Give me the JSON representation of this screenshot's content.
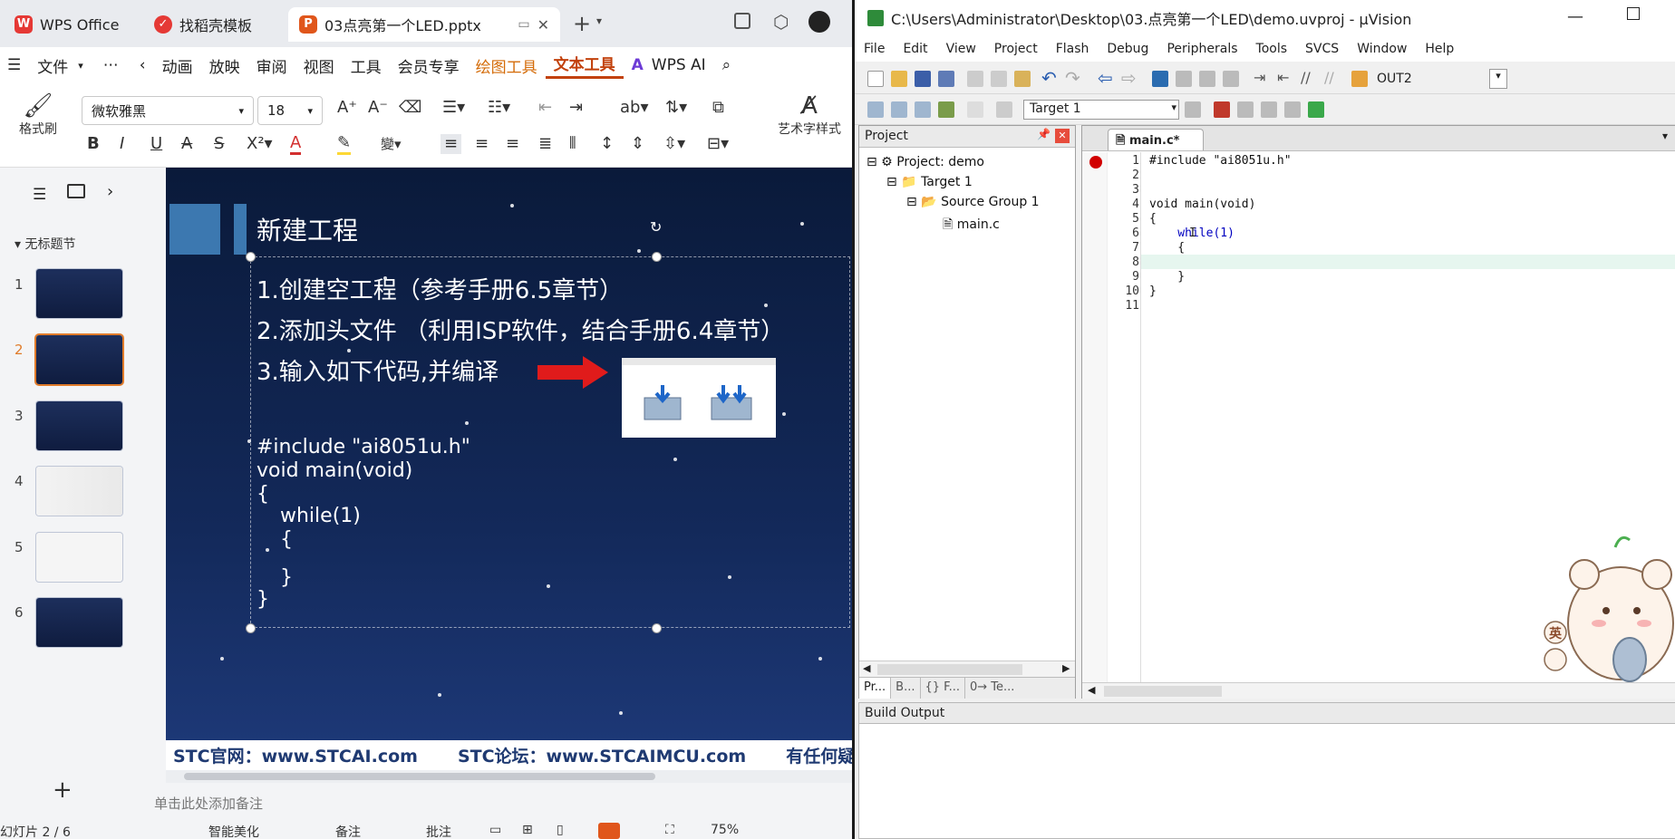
{
  "wps": {
    "tabs": [
      "WPS Office",
      "找稻壳模板",
      "03点亮第一个LED.pptx"
    ],
    "menu": [
      "文件",
      "⋯",
      "动画",
      "放映",
      "审阅",
      "视图",
      "工具",
      "会员专享",
      "绘图工具",
      "文本工具",
      "WPS AI"
    ],
    "ribbon": {
      "format_painter": "格式刷",
      "font_name": "微软雅黑",
      "font_size": "18",
      "art_style": "艺术字样式"
    },
    "section": "无标题节",
    "slide_numbers": [
      "1",
      "2",
      "3",
      "4",
      "5",
      "6"
    ],
    "slide": {
      "title": "新建工程",
      "line1": "1.创建空工程（参考手册6.5章节）",
      "line2": "2.添加头文件 （利用ISP软件，结合手册6.4章节）",
      "line3": "3.输入如下代码,并编译",
      "code": [
        "#include \"ai8051u.h\"",
        "void main(void)",
        "{",
        "while(1)",
        "{",
        "}",
        "}"
      ],
      "footer1": "STC官网：www.STCAI.com",
      "footer2": "STC论坛：www.STCAIMCU.com",
      "footer3": "有任何疑问者"
    },
    "notes_placeholder": "单击此处添加备注",
    "status": {
      "slide_info": "幻灯片 2 / 6",
      "smart": "智能美化",
      "notes": "备注",
      "comment": "批注",
      "zoom": "75%"
    }
  },
  "uvision": {
    "title": "C:\\Users\\Administrator\\Desktop\\03.点亮第一个LED\\demo.uvproj - µVision",
    "menu": [
      "File",
      "Edit",
      "View",
      "Project",
      "Flash",
      "Debug",
      "Peripherals",
      "Tools",
      "SVCS",
      "Window",
      "Help"
    ],
    "out_label": "OUT2",
    "target_select": "Target 1",
    "project_header": "Project",
    "tree": [
      "Project: demo",
      "Target 1",
      "Source Group 1",
      "main.c"
    ],
    "bottom_tabs": [
      "Pr...",
      "B...",
      "{} F...",
      "0→ Te..."
    ],
    "editor_tab": "main.c*",
    "code_lines": [
      "#include \"ai8051u.h\"",
      "",
      "",
      "void main(void)",
      "{",
      "    while(1)",
      "    {",
      "",
      "    }",
      "}",
      ""
    ],
    "line_numbers": [
      "1",
      "2",
      "3",
      "4",
      "5",
      "6",
      "7",
      "8",
      "9",
      "10",
      "11"
    ],
    "build_output": "Build Output",
    "sticker_char": "英"
  }
}
